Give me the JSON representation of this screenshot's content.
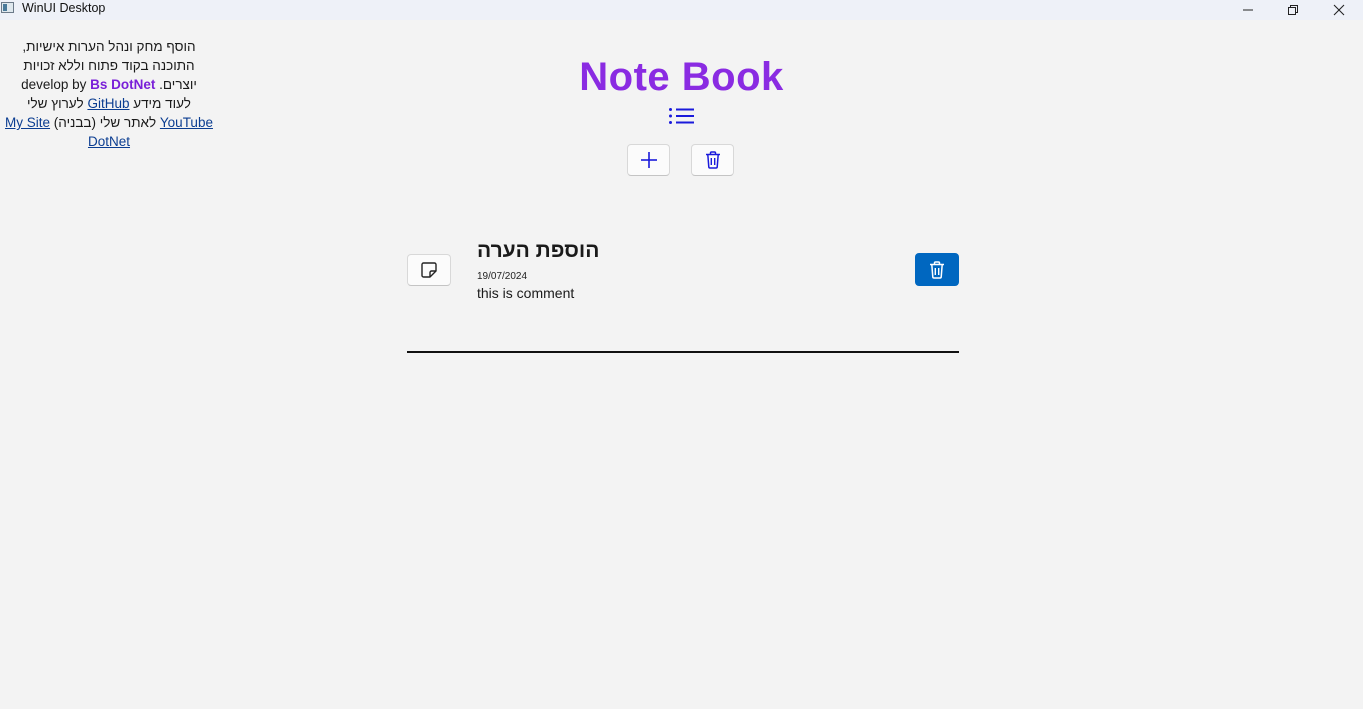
{
  "window": {
    "title": "WinUI Desktop",
    "minimize_icon": "minimize-icon",
    "maximize_icon": "restore-icon",
    "close_icon": "close-icon"
  },
  "sidebar": {
    "line1": "הוסף מחק ונהל הערות אישיות,",
    "line2": "התוכנה בקוד פתוח וללא זכויות",
    "line3_prefix": "יוצרים. develop by ",
    "brand": "Bs DotNet",
    "line4_prefix": "לעוד מידע ",
    "github_link": "GitHub",
    "line4_suffix": " לערוץ שלי",
    "youtube_link": "YouTube",
    "line5_middle": " לאתר שלי (בבניה) ",
    "site_link": "My Site DotNet"
  },
  "header": {
    "title": "Note Book",
    "title_color": "#8a2be2",
    "list_icon": "list-icon"
  },
  "toolbar": {
    "add_icon": "plus-icon",
    "delete_all_icon": "trash-icon"
  },
  "notes": [
    {
      "title": "הוספת הערה",
      "date": "19/07/2024",
      "comment": "this is comment",
      "icon": "sticky-note-icon",
      "delete_icon": "trash-icon",
      "delete_color": "#0067c0"
    }
  ]
}
